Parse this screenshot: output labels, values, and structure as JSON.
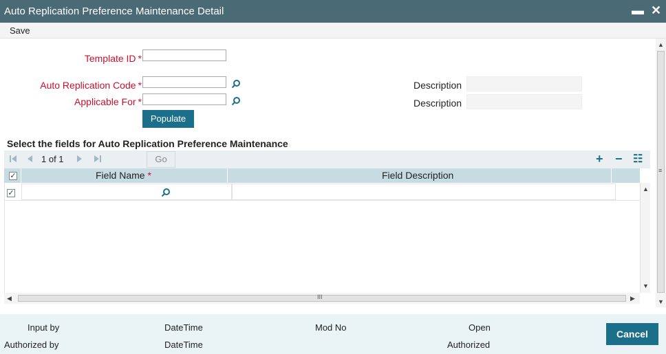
{
  "window": {
    "title": "Auto Replication Preference Maintenance Detail",
    "minimize_symbol": "▬",
    "close_symbol": "✕"
  },
  "menu": {
    "save_label": "Save"
  },
  "form": {
    "template_id_label": "Template ID",
    "auto_replication_code_label": "Auto Replication Code",
    "applicable_for_label": "Applicable For",
    "required_marker": "*",
    "description_label_1": "Description",
    "description_label_2": "Description",
    "template_id_value": "",
    "auto_replication_code_value": "",
    "applicable_for_value": "",
    "populate_label": "Populate"
  },
  "grid": {
    "section_title": "Select the fields for Auto Replication Preference Maintenance",
    "pager_text": "1 of 1",
    "go_label": "Go",
    "add_symbol": "+",
    "remove_symbol": "−",
    "view_symbol": "☷",
    "columns": [
      "Field Name",
      "Field Description"
    ],
    "required_marker": "*",
    "rows": [
      {
        "field_name": "",
        "field_description": "",
        "checked": true
      }
    ],
    "scroll_marker": "III"
  },
  "footer": {
    "input_by": "Input by",
    "datetime_1": "DateTime",
    "mod_no": "Mod No",
    "open": "Open",
    "authorized_by": "Authorized by",
    "datetime_2": "DateTime",
    "authorized": "Authorized",
    "cancel_label": "Cancel"
  },
  "colors": {
    "titlebar": "#4a6b76",
    "accent": "#1b6f8a",
    "required_label": "#c8102e",
    "grid_header": "#c7dbe3",
    "footer": "#eaf3f5"
  }
}
